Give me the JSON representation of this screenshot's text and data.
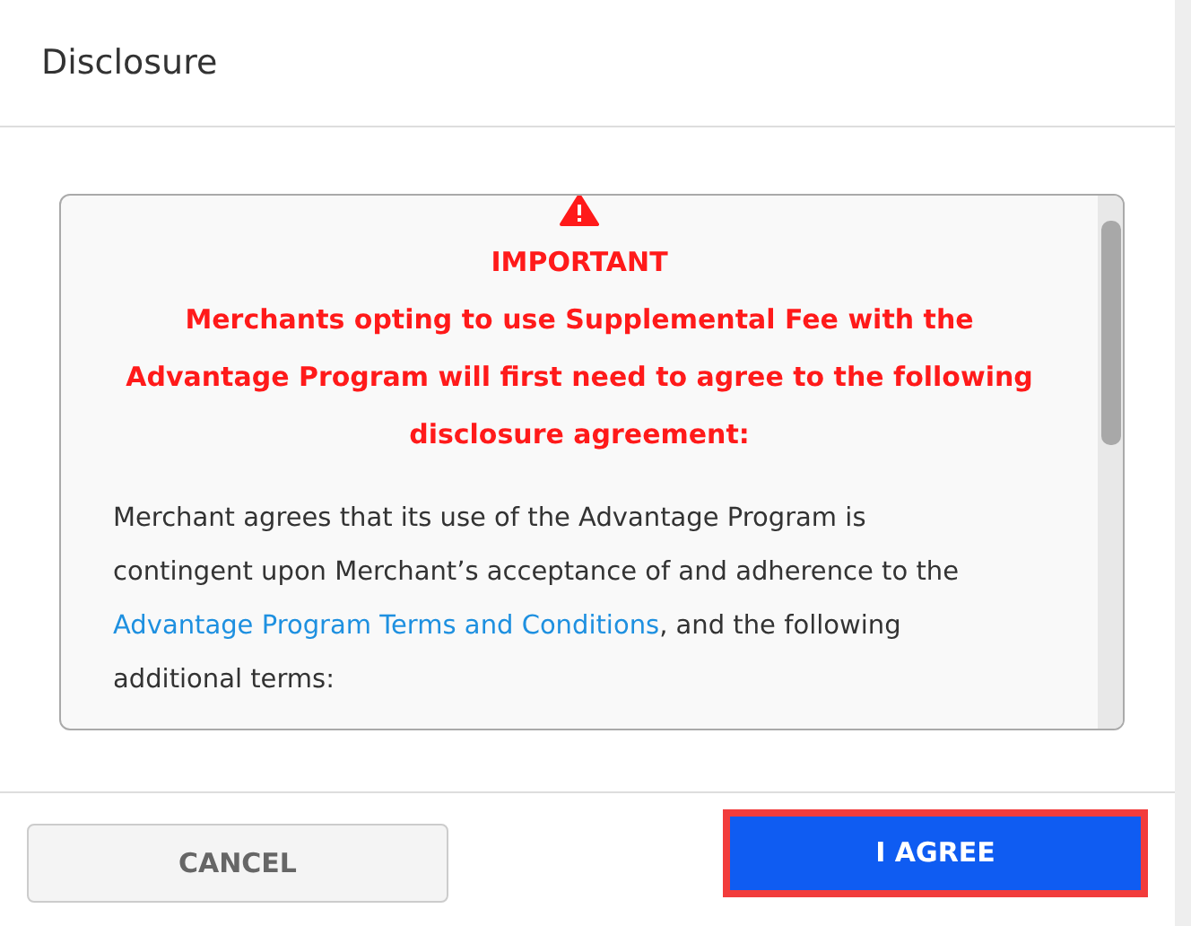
{
  "dialog": {
    "title": "Disclosure"
  },
  "notice": {
    "heading": "IMPORTANT",
    "message": "Merchants opting to use Supplemental Fee with the Advantage Program will first need to agree to the following disclosure agreement:"
  },
  "terms": {
    "text_before": "Merchant agrees that its use of the Advantage Program is contingent upon Merchant’s acceptance of and adherence to the ",
    "link": "Advantage Program Terms and Conditions",
    "text_after": ", and the following additional terms:"
  },
  "buttons": [
    {
      "label": "CANCEL",
      "kind": "secondary"
    },
    {
      "label": "I AGREE",
      "kind": "primary"
    }
  ]
}
